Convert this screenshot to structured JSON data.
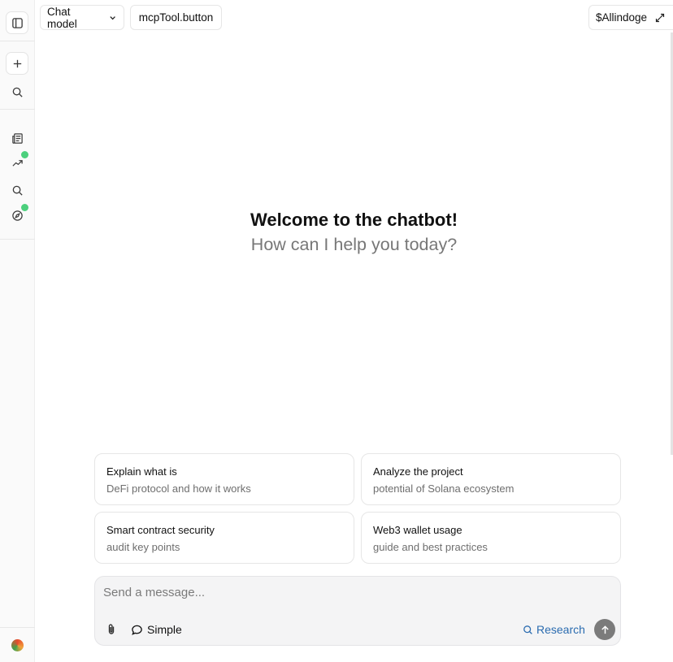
{
  "topbar": {
    "model_label": "Chat model",
    "tool_label": "mcpTool.button",
    "token_label": "$Allindoge"
  },
  "welcome": {
    "title": "Welcome to the chatbot!",
    "subtitle": "How can I help you today?"
  },
  "suggestions": [
    {
      "title": "Explain what is",
      "subtitle": "DeFi protocol and how it works"
    },
    {
      "title": "Analyze the project",
      "subtitle": "potential of Solana ecosystem"
    },
    {
      "title": "Smart contract security",
      "subtitle": "audit key points"
    },
    {
      "title": "Web3 wallet usage",
      "subtitle": "guide and best practices"
    }
  ],
  "composer": {
    "placeholder": "Send a message...",
    "value": "",
    "mode_label": "Simple",
    "research_label": "Research"
  },
  "colors": {
    "badge": "#4cd07d",
    "research": "#2b6cb0",
    "send_button": "#7b7b7b"
  },
  "icons": {
    "rail": [
      "sidebar-toggle-icon",
      "plus-icon",
      "search-icon",
      "newspaper-icon",
      "trending-icon",
      "search-icon",
      "compass-icon"
    ],
    "topbar": [
      "chevron-down-icon",
      "external-expand-icon"
    ],
    "composer": [
      "paperclip-icon",
      "chat-bubble-icon",
      "search-icon",
      "arrow-up-icon"
    ]
  }
}
